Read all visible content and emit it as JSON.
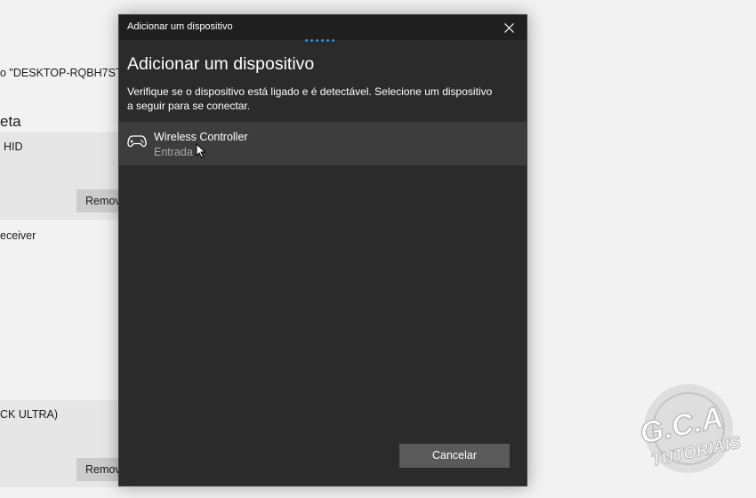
{
  "background": {
    "device_name_line": "o \"DESKTOP-RQBH7ST\"",
    "section_heading": "eta",
    "items": [
      {
        "label": "HID",
        "button": "Remov"
      },
      {
        "label": "eceiver"
      },
      {
        "label": "CK ULTRA)",
        "button": "Remov"
      }
    ]
  },
  "dialog": {
    "window_title": "Adicionar um dispositivo",
    "heading": "Adicionar um dispositivo",
    "description": "Verifique se o dispositivo está ligado e é detectável. Selecione um dispositivo a seguir para se conectar.",
    "devices": [
      {
        "name": "Wireless Controller",
        "type": "Entrada",
        "icon": "gamepad-icon"
      }
    ],
    "cancel_label": "Cancelar",
    "accent_color": "#2f8fd8"
  },
  "watermark": {
    "line1": "G.C.A",
    "line2": "TUTORIAIS"
  }
}
